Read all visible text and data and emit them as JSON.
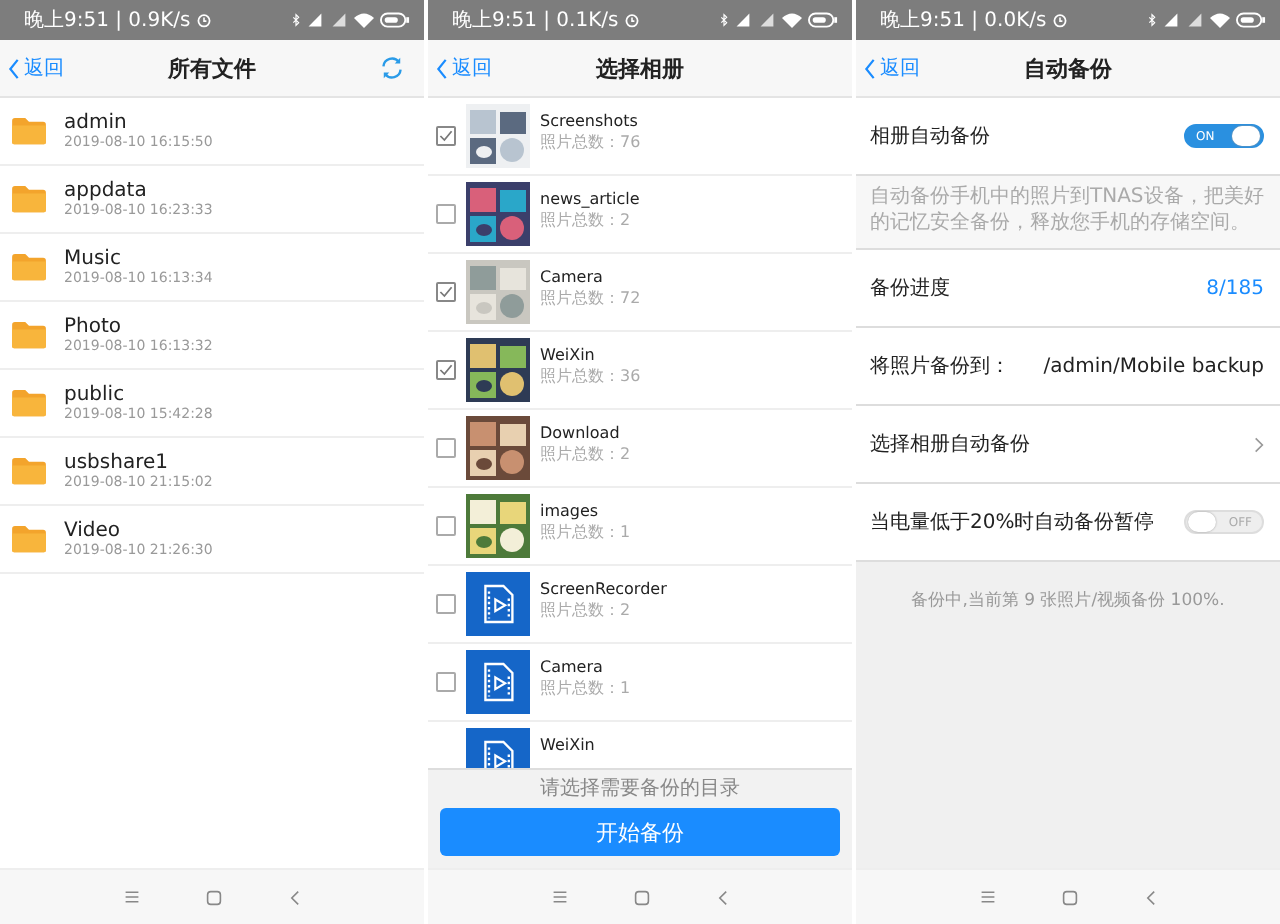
{
  "panels": [
    {
      "kind": "files",
      "status": {
        "time": "晚上9:51 | 0.9K/s"
      },
      "header": {
        "back": "返回",
        "title": "所有文件"
      },
      "folders": [
        {
          "name": "admin",
          "date": "2019-08-10 16:15:50"
        },
        {
          "name": "appdata",
          "date": "2019-08-10 16:23:33"
        },
        {
          "name": "Music",
          "date": "2019-08-10 16:13:34"
        },
        {
          "name": "Photo",
          "date": "2019-08-10 16:13:32"
        },
        {
          "name": "public",
          "date": "2019-08-10 15:42:28"
        },
        {
          "name": "usbshare1",
          "date": "2019-08-10 21:15:02"
        },
        {
          "name": "Video",
          "date": "2019-08-10 21:26:30"
        }
      ]
    },
    {
      "kind": "albums",
      "status": {
        "time": "晚上9:51 | 0.1K/s"
      },
      "header": {
        "back": "返回",
        "title": "选择相册"
      },
      "albums": [
        {
          "name": "Screenshots",
          "count": "照片总数：76",
          "checked": true,
          "kind": "picture"
        },
        {
          "name": "news_article",
          "count": "照片总数：2",
          "checked": false,
          "kind": "picture"
        },
        {
          "name": "Camera",
          "count": "照片总数：72",
          "checked": true,
          "kind": "picture"
        },
        {
          "name": "WeiXin",
          "count": "照片总数：36",
          "checked": true,
          "kind": "picture"
        },
        {
          "name": "Download",
          "count": "照片总数：2",
          "checked": false,
          "kind": "picture"
        },
        {
          "name": "images",
          "count": "照片总数：1",
          "checked": false,
          "kind": "picture"
        },
        {
          "name": "ScreenRecorder",
          "count": "照片总数：2",
          "checked": false,
          "kind": "video"
        },
        {
          "name": "Camera",
          "count": "照片总数：1",
          "checked": false,
          "kind": "video"
        },
        {
          "name": "WeiXin",
          "kind": "video"
        }
      ],
      "hint": "请选择需要备份的目录",
      "button": "开始备份"
    },
    {
      "kind": "settings",
      "status": {
        "time": "晚上9:51 | 0.0K/s"
      },
      "header": {
        "back": "返回",
        "title": "自动备份"
      },
      "rows": [
        {
          "kind": "toggle",
          "label": "相册自动备份",
          "on": true,
          "switch_text": "ON"
        },
        {
          "kind": "note",
          "text": "自动备份手机中的照片到TNAS设备，把美好的记忆安全备份，释放您手机的存储空间。"
        },
        {
          "kind": "value",
          "label": "备份进度",
          "value": "8/185",
          "accent": true
        },
        {
          "kind": "value",
          "label": "将照片备份到：",
          "value": "/admin/Mobile backup",
          "accent": false
        },
        {
          "kind": "link",
          "label": "选择相册自动备份"
        },
        {
          "kind": "toggle",
          "label": "当电量低于20%时自动备份暂停",
          "on": false,
          "switch_text": "OFF"
        }
      ],
      "footer": "备份中,当前第 9 张照片/视频备份 100%."
    }
  ]
}
